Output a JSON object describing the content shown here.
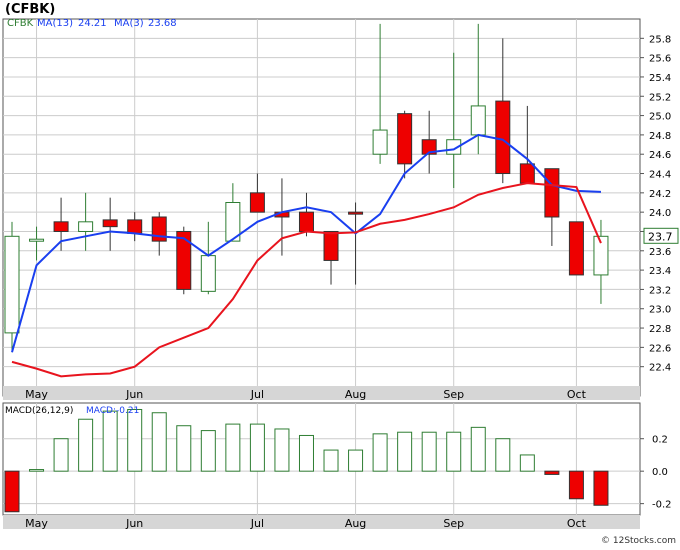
{
  "header": {
    "ticker": "(CFBK)",
    "legend_symbol": "CFBK",
    "ma13_label": "MA(13)",
    "ma13_value": "24.21",
    "ma3_label": "MA(3)",
    "ma3_value": "23.68"
  },
  "last_price_label": "23.7",
  "watermark": "© 12Stocks.com",
  "colors": {
    "up_candle": "#2e7d32",
    "down_candle_fill": "#ee0000",
    "ma13_line": "#1a3ff0",
    "ma3_line": "#e8141e",
    "panel_bg": "#ffffff",
    "grid": "#cccccc",
    "axis_strip": "#d6d6d6",
    "macd_up": "#2e7d32",
    "macd_down": "#ee0000"
  },
  "chart_data": [
    {
      "type": "candlestick",
      "x_labels": [
        "May",
        "Jun",
        "Jul",
        "Aug",
        "Sep",
        "Oct"
      ],
      "x_label_weeks": [
        1,
        5,
        10,
        14,
        18,
        23
      ],
      "y_ticks": [
        22.4,
        22.6,
        22.8,
        23.0,
        23.2,
        23.4,
        23.6,
        23.8,
        24.0,
        24.2,
        24.4,
        24.6,
        24.8,
        25.0,
        25.2,
        25.4,
        25.6,
        25.8
      ],
      "ylim": [
        22.2,
        26.0
      ],
      "grid": true,
      "candles": [
        {
          "o": 22.75,
          "h": 23.9,
          "l": 22.55,
          "c": 23.75
        },
        {
          "o": 23.7,
          "h": 23.85,
          "l": 23.5,
          "c": 23.72
        },
        {
          "o": 23.9,
          "h": 24.15,
          "l": 23.6,
          "c": 23.8
        },
        {
          "o": 23.8,
          "h": 24.2,
          "l": 23.6,
          "c": 23.9
        },
        {
          "o": 23.92,
          "h": 24.15,
          "l": 23.6,
          "c": 23.85
        },
        {
          "o": 23.92,
          "h": 24.0,
          "l": 23.7,
          "c": 23.78
        },
        {
          "o": 23.95,
          "h": 24.0,
          "l": 23.55,
          "c": 23.7
        },
        {
          "o": 23.8,
          "h": 23.85,
          "l": 23.15,
          "c": 23.2
        },
        {
          "o": 23.18,
          "h": 23.9,
          "l": 23.15,
          "c": 23.55
        },
        {
          "o": 23.7,
          "h": 24.3,
          "l": 23.7,
          "c": 24.1
        },
        {
          "o": 24.2,
          "h": 24.4,
          "l": 24.0,
          "c": 24.0
        },
        {
          "o": 24.0,
          "h": 24.35,
          "l": 23.55,
          "c": 23.95
        },
        {
          "o": 24.0,
          "h": 24.2,
          "l": 23.75,
          "c": 23.8
        },
        {
          "o": 23.8,
          "h": 23.8,
          "l": 23.25,
          "c": 23.5
        },
        {
          "o": 24.0,
          "h": 24.1,
          "l": 23.25,
          "c": 23.98
        },
        {
          "o": 24.6,
          "h": 25.95,
          "l": 24.5,
          "c": 24.85
        },
        {
          "o": 25.02,
          "h": 25.05,
          "l": 24.35,
          "c": 24.5
        },
        {
          "o": 24.75,
          "h": 25.05,
          "l": 24.4,
          "c": 24.6
        },
        {
          "o": 24.6,
          "h": 25.65,
          "l": 24.25,
          "c": 24.75
        },
        {
          "o": 24.8,
          "h": 25.95,
          "l": 24.6,
          "c": 25.1
        },
        {
          "o": 25.15,
          "h": 25.8,
          "l": 24.3,
          "c": 24.4
        },
        {
          "o": 24.5,
          "h": 25.1,
          "l": 24.3,
          "c": 24.3
        },
        {
          "o": 24.45,
          "h": 24.45,
          "l": 23.65,
          "c": 23.95
        },
        {
          "o": 23.9,
          "h": 23.9,
          "l": 23.35,
          "c": 23.35
        },
        {
          "o": 23.35,
          "h": 23.92,
          "l": 23.05,
          "c": 23.75
        }
      ],
      "series": [
        {
          "name": "MA(13)",
          "values": [
            22.55,
            23.45,
            23.7,
            23.75,
            23.8,
            23.78,
            23.75,
            23.73,
            23.55,
            23.72,
            23.9,
            24.0,
            24.05,
            24.0,
            23.78,
            23.98,
            24.4,
            24.62,
            24.65,
            24.8,
            24.75,
            24.55,
            24.28,
            24.22,
            24.21
          ]
        },
        {
          "name": "MA(3)",
          "values": [
            22.45,
            22.38,
            22.3,
            22.32,
            22.33,
            22.4,
            22.6,
            22.7,
            22.8,
            23.1,
            23.5,
            23.73,
            23.8,
            23.78,
            23.79,
            23.88,
            23.92,
            23.98,
            24.05,
            24.18,
            24.25,
            24.3,
            24.28,
            24.26,
            23.68
          ]
        }
      ]
    },
    {
      "type": "bar",
      "title": "MACD(26,12,9)",
      "value_label": "MACD:-0.21",
      "x_labels": [
        "May",
        "Jun",
        "Jul",
        "Aug",
        "Sep",
        "Oct"
      ],
      "y_ticks": [
        0.2,
        0.0,
        -0.2
      ],
      "y_tick_labels": [
        "0.2",
        "0.0",
        "-0.2"
      ],
      "ylim": [
        -0.27,
        0.42
      ],
      "values": [
        -0.25,
        0.01,
        0.2,
        0.32,
        0.37,
        0.38,
        0.36,
        0.28,
        0.25,
        0.29,
        0.29,
        0.26,
        0.22,
        0.13,
        0.13,
        0.23,
        0.24,
        0.24,
        0.24,
        0.27,
        0.2,
        0.1,
        -0.02,
        -0.17,
        -0.21
      ]
    }
  ]
}
